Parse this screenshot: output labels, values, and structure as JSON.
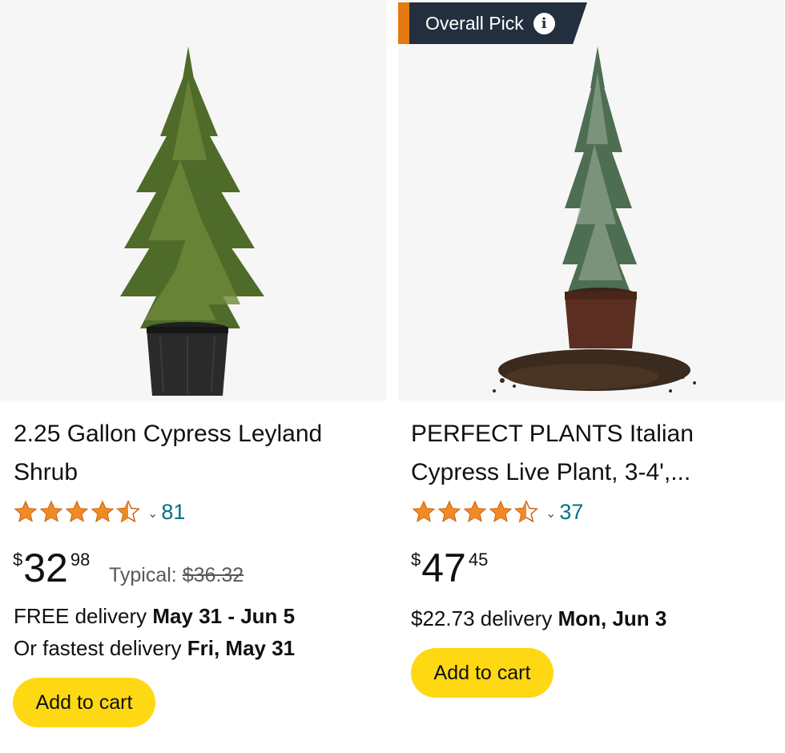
{
  "products": [
    {
      "title": "2.25 Gallon Cypress Leyland Shrub",
      "rating": 4.5,
      "review_count": "81",
      "price": {
        "symbol": "$",
        "whole": "32",
        "fraction": "98"
      },
      "typical_label": "Typical:",
      "typical_price": "$36.32",
      "delivery_line1_prefix": "FREE delivery",
      "delivery_line1_date": "May 31 - Jun 5",
      "delivery_line2_prefix": "Or fastest delivery",
      "delivery_line2_date": "Fri, May 31",
      "cart_label": "Add to cart"
    },
    {
      "badge": "Overall Pick",
      "badge_icon": "info-icon",
      "title": "PERFECT PLANTS Italian Cypress Live Plant, 3-4',...",
      "rating": 4.5,
      "review_count": "37",
      "price": {
        "symbol": "$",
        "whole": "47",
        "fraction": "45"
      },
      "delivery_line1_prefix": "$22.73 delivery",
      "delivery_line1_date": "Mon, Jun 3",
      "cart_label": "Add to cart"
    }
  ],
  "colors": {
    "star": "#f08a24",
    "link": "#007185",
    "cart_button": "#ffd814",
    "badge_bg": "#232f3e",
    "badge_accent": "#e47911"
  }
}
